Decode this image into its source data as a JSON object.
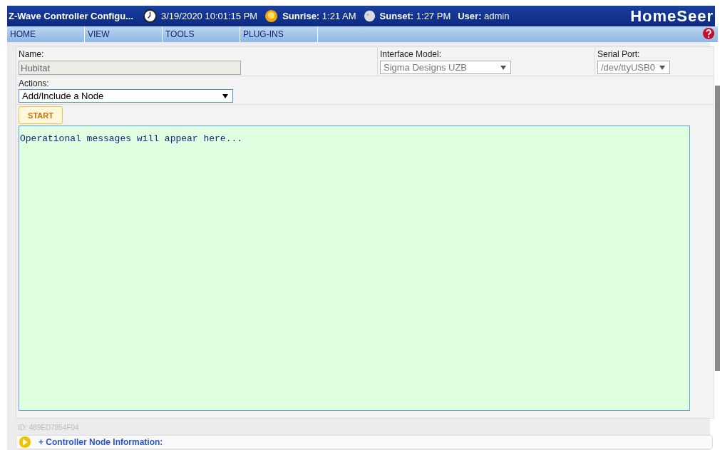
{
  "header": {
    "title": "Z-Wave Controller Configu...",
    "datetime": "3/19/2020 10:01:15 PM",
    "sunrise_label": "Sunrise:",
    "sunrise": "1:21 AM",
    "sunset_label": "Sunset:",
    "sunset": "1:27 PM",
    "user_label": "User:",
    "user": "admin",
    "logo": "HomeSeer"
  },
  "menu": [
    {
      "label": "HOME"
    },
    {
      "label": "VIEW"
    },
    {
      "label": "TOOLS"
    },
    {
      "label": "PLUG-INS"
    }
  ],
  "form": {
    "name_label": "Name:",
    "name_value": "Hubitat",
    "model_label": "Interface Model:",
    "model_value": "Sigma Designs UZB",
    "port_label": "Serial Port:",
    "port_value": "/dev/ttyUSB0",
    "actions_label": "Actions:",
    "actions_value": "Add/Include a Node",
    "start_button": "START",
    "log": "Operational messages will appear here..."
  },
  "id_text": "ID: 489ED7854F04",
  "section": {
    "expand_mark": "+",
    "title": "Controller Node Information:"
  }
}
